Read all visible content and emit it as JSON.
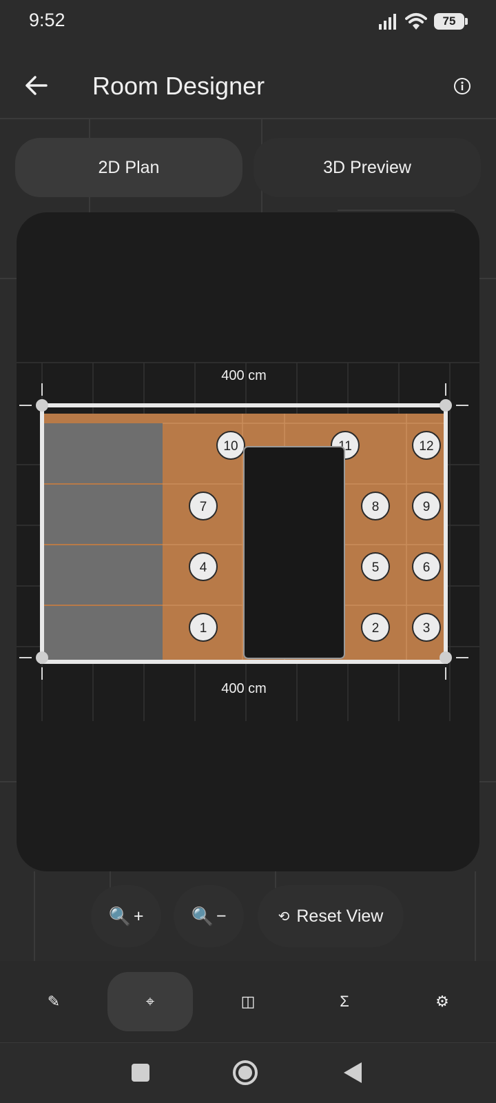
{
  "status_bar": {
    "time": "9:52",
    "battery": "75"
  },
  "app_bar": {
    "title": "Room Designer"
  },
  "tabs": [
    {
      "label": "2D Plan",
      "selected": true
    },
    {
      "label": "3D Preview",
      "selected": false
    }
  ],
  "plan": {
    "width_label_top": "400 cm",
    "width_label_bottom": "400 cm",
    "seats": [
      "1",
      "2",
      "3",
      "4",
      "5",
      "6",
      "7",
      "8",
      "9",
      "10",
      "11",
      "12"
    ]
  },
  "zoom": {
    "zoom_in_symbol": "+",
    "zoom_out_symbol": "−",
    "reset_label": "Reset View"
  },
  "bottom_nav": [
    {
      "icon": "pencil-icon",
      "glyph": "✎",
      "active": false
    },
    {
      "icon": "crosshair-icon",
      "glyph": "⌖",
      "active": true
    },
    {
      "icon": "split-view-icon",
      "glyph": "◫",
      "active": false
    },
    {
      "icon": "sigma-icon",
      "glyph": "Σ",
      "active": false
    },
    {
      "icon": "gear-icon",
      "glyph": "⚙",
      "active": false
    }
  ],
  "colors": {
    "background": "#2c2c2c",
    "canvas": "#1c1c1c",
    "floor": "#b87a48",
    "storage": "#6e6e6e",
    "wall": "#e8e8e8"
  }
}
